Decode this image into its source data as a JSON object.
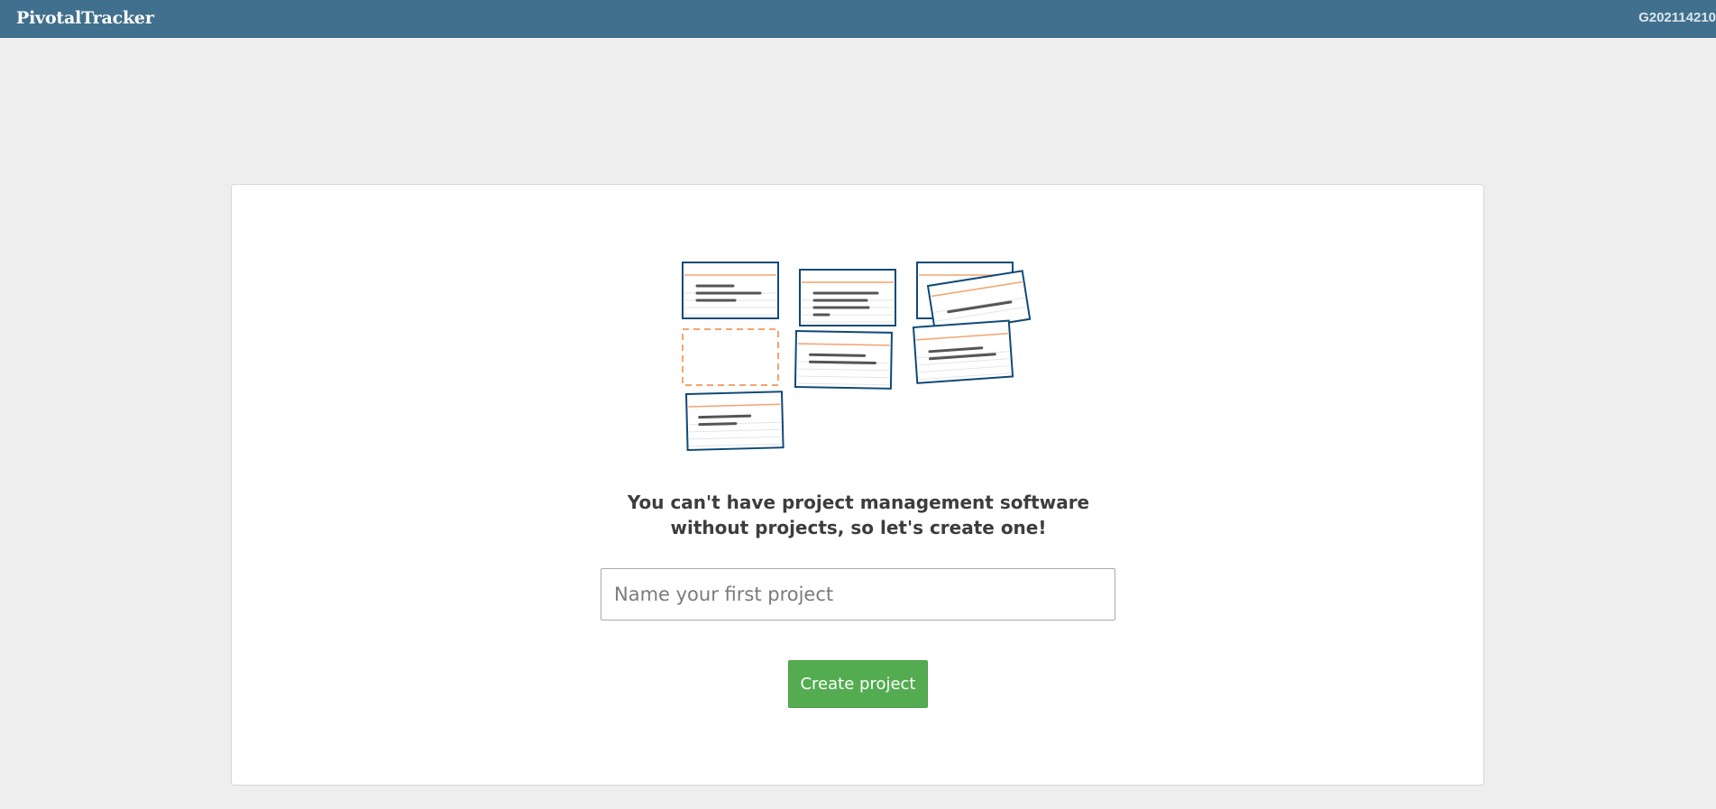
{
  "header": {
    "logo_text": "PivotalTracker",
    "account_id": "G202114210"
  },
  "onboarding": {
    "headline_line1": "You can't have project management software",
    "headline_line2": "without projects, so let's create one!",
    "project_name_placeholder": "Name your first project",
    "project_name_value": "",
    "create_button_label": "Create project"
  },
  "colors": {
    "topbar": "#41708e",
    "page_background": "#eeeeee",
    "card_border": "#0f4a78",
    "card_accent_line": "#f5a36d",
    "button": "#54ac51"
  }
}
